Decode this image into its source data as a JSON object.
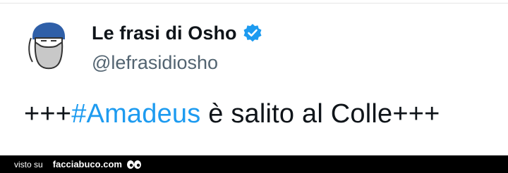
{
  "tweet": {
    "display_name": "Le frasi di Osho",
    "handle": "@lefrasidiosho",
    "text_prefix": "+++",
    "hashtag": "#Amadeus",
    "text_suffix": " è salito al Colle+++",
    "avatar_icon": "bearded-face-icon",
    "verified_icon": "verified-badge-icon"
  },
  "footer": {
    "prefix": "visto su",
    "site": "facciabuco.com",
    "logo_icon": "eyes-icon"
  },
  "colors": {
    "hashtag": "#1d9bf0",
    "verified": "#1d9bf0",
    "text": "#0f1419",
    "handle": "#536471",
    "footer_bg": "#000000"
  }
}
